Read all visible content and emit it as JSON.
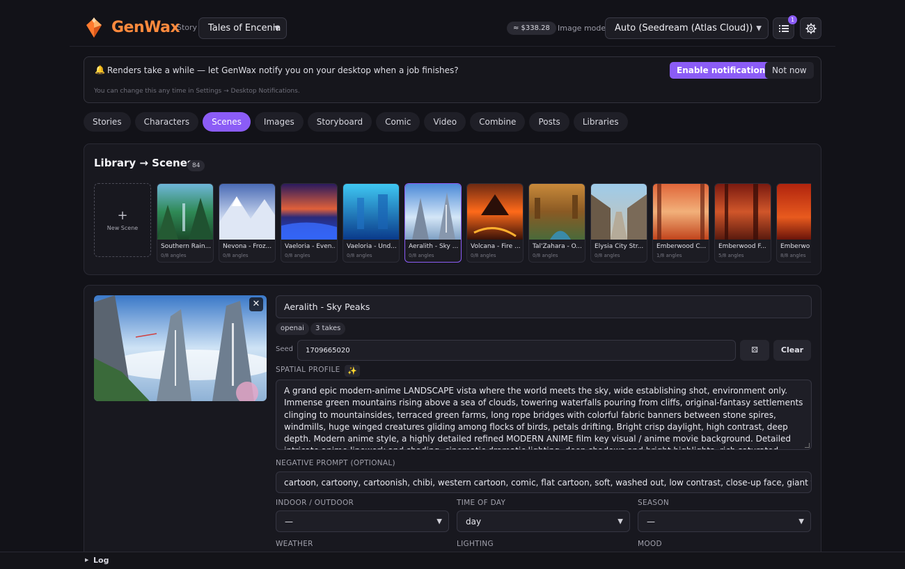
{
  "header": {
    "brand": "GenWax",
    "story_label": "Story",
    "story_value": "Tales of Encenia",
    "cost": "≈ $338.28",
    "model_label": "Image model",
    "model_value": "Auto (Seedream (Atlas Cloud))",
    "queue_count": "1",
    "icons": {
      "logo": "genwax-logo",
      "queue": "list-icon",
      "settings": "gear-icon"
    },
    "accent_color": "#8b5cf6",
    "brand_color": "#ff8a3d"
  },
  "banner": {
    "icon": "bell-icon",
    "text": "Renders take a while — let GenWax notify you on your desktop when a job finishes?",
    "subtext": "You can change this any time in Settings → Desktop Notifications.",
    "enable_label": "Enable notifications",
    "dismiss_label": "Not now"
  },
  "tabs": [
    {
      "label": "Stories",
      "active": false
    },
    {
      "label": "Characters",
      "active": false
    },
    {
      "label": "Scenes",
      "active": true
    },
    {
      "label": "Images",
      "active": false
    },
    {
      "label": "Storyboard",
      "active": false
    },
    {
      "label": "Comic",
      "active": false
    },
    {
      "label": "Video",
      "active": false
    },
    {
      "label": "Combine",
      "active": false
    },
    {
      "label": "Posts",
      "active": false
    },
    {
      "label": "Libraries",
      "active": false
    }
  ],
  "library": {
    "title": "Library → Scenes",
    "count": "84",
    "new_label": "New Scene",
    "scenes": [
      {
        "name": "Southern Rain...",
        "angles": "0/8 angles",
        "selected": false
      },
      {
        "name": "Nevona - Froz...",
        "angles": "0/8 angles",
        "selected": false
      },
      {
        "name": "Vaeloria - Even...",
        "angles": "0/8 angles",
        "selected": false
      },
      {
        "name": "Vaeloria - Und...",
        "angles": "0/8 angles",
        "selected": false
      },
      {
        "name": "Aeralith - Sky ...",
        "angles": "0/8 angles",
        "selected": true
      },
      {
        "name": "Volcana - Fire ...",
        "angles": "0/8 angles",
        "selected": false
      },
      {
        "name": "Tal'Zahara - O...",
        "angles": "0/8 angles",
        "selected": false
      },
      {
        "name": "Elysia City Str...",
        "angles": "0/8 angles",
        "selected": false
      },
      {
        "name": "Emberwood C...",
        "angles": "1/8 angles",
        "selected": false
      },
      {
        "name": "Emberwood F...",
        "angles": "5/8 angles",
        "selected": false
      },
      {
        "name": "Emberwo",
        "angles": "8/8 angles",
        "selected": false
      }
    ]
  },
  "editor": {
    "scene_name": "Aeralith - Sky Peaks",
    "chips": [
      "openai",
      "3 takes"
    ],
    "seed_label": "Seed",
    "seed_value": "1709665020",
    "dice_icon": "dice-icon",
    "clear_label": "Clear",
    "spatial_label": "SPATIAL PROFILE",
    "sparkle_icon": "sparkle-icon",
    "prompt": "A grand epic modern-anime LANDSCAPE vista where the world meets the sky, wide establishing shot, environment only. Immense green mountains rising above a sea of clouds, towering waterfalls pouring from cliffs, original-fantasy settlements clinging to mountainsides, terraced green farms, long rope bridges with colorful fabric banners between stone spires, windmills, huge winged creatures gliding among flocks of birds, petals drifting. Bright crisp daylight, high contrast, deep depth. Modern anime style, a highly detailed refined MODERN ANIME film key visual / anime movie background. Detailed intricate anime linework and shading, cinematic dramatic lighting, deep shadows and bright highlights, rich saturated color, strong depth and high contrast. Distinctly MODERN ANIME, sleek and refined.",
    "negative_label": "NEGATIVE PROMPT (OPTIONAL)",
    "negative_value": "cartoon, cartoony, cartoonish, chibi, western cartoon, comic, flat cartoon, soft, washed out, low contrast, close-up face, giant face, foregro",
    "indoor_label": "INDOOR / OUTDOOR",
    "indoor_value": "—",
    "time_label": "TIME OF DAY",
    "time_value": "day",
    "season_label": "SEASON",
    "season_value": "—",
    "weather_label": "WEATHER",
    "lighting_label": "LIGHTING",
    "mood_label": "MOOD"
  },
  "footer": {
    "log_label": "Log"
  }
}
